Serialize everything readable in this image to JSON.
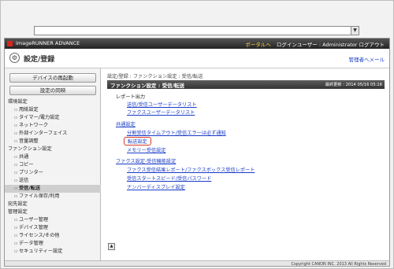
{
  "titlebar": {
    "brand": "imageRUNNER ADVANCE",
    "portal_link": "ポータルへ",
    "login_user": "ログインユーザー : Administrator ログアウト"
  },
  "header": {
    "title": "設定/登録",
    "mgmt_link": "管理者へメール"
  },
  "sidebar": {
    "buttons": [
      "デバイスの再起動",
      "設定の同映"
    ],
    "items": [
      {
        "label": "環境設定",
        "kind": "section"
      },
      {
        "label": "用紙設定",
        "kind": "sub"
      },
      {
        "label": "タイマー/電力設定",
        "kind": "sub"
      },
      {
        "label": "ネットワーク",
        "kind": "sub"
      },
      {
        "label": "外部インターフェイス",
        "kind": "sub"
      },
      {
        "label": "音量調整",
        "kind": "sub"
      },
      {
        "label": "ファンクション設定",
        "kind": "section"
      },
      {
        "label": "共通",
        "kind": "sub"
      },
      {
        "label": "コピー",
        "kind": "sub"
      },
      {
        "label": "プリンター",
        "kind": "sub"
      },
      {
        "label": "送信",
        "kind": "sub"
      },
      {
        "label": "受信/転送",
        "kind": "sub",
        "selected": true
      },
      {
        "label": "ファイル保存/利用",
        "kind": "sub"
      },
      {
        "label": "宛先設定",
        "kind": "section"
      },
      {
        "label": "管理設定",
        "kind": "section"
      },
      {
        "label": "ユーザー管理",
        "kind": "sub"
      },
      {
        "label": "デバイス管理",
        "kind": "sub"
      },
      {
        "label": "ライセンス/その他",
        "kind": "sub"
      },
      {
        "label": "データ管理",
        "kind": "sub"
      },
      {
        "label": "セキュリティー設定",
        "kind": "sub"
      }
    ]
  },
  "main": {
    "breadcrumb": "設定/登録 : ファンクション設定 : 受信/転送",
    "section_title": "ファンクション設定 : 受信/転送",
    "last_updated": "最終更新 : 2014 05/16 05:16",
    "report_heading": "レポート出力",
    "report_link1": "送信/受信ユーザーデータリスト",
    "report_link2": "ファクスユーザーデータリスト",
    "common_link": "共通設定",
    "common_sub1": "分割受信タイムアウト/受信エラーは必ず通知",
    "transfer_link": "転送設定",
    "memory_link": "メモリー受信設定",
    "fax_link": "ファクス設定-受信機能設定",
    "fax_sub1": "ファクス受信結果レポート/ファクスボックス受信レポート",
    "fax_sub2": "受信スタートスピード/受信パスワード",
    "fax_sub3": "ナンバーディスプレイ設定",
    "top_icon": "up-arrow-icon"
  },
  "footer": {
    "copyright": "Copyright CANON INC. 2013 All Rights Reserved"
  },
  "colors": {
    "titlebar_bg": "#2a2a2a",
    "link": "#1a3cc7",
    "highlight": "#d63a2a",
    "brand_red": "#d9251c"
  }
}
